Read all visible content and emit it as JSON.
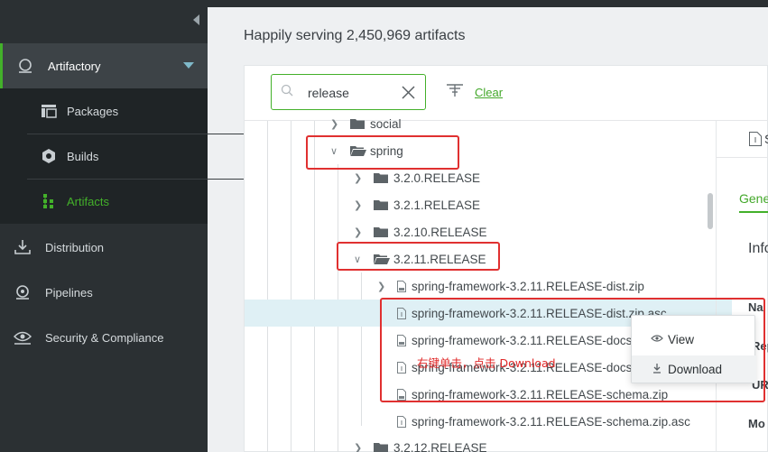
{
  "sidebar": {
    "artifactory_label": "Artifactory",
    "sub_items": [
      {
        "label": "Packages",
        "icon": "packages-icon"
      },
      {
        "label": "Builds",
        "icon": "builds-icon"
      },
      {
        "label": "Artifacts",
        "icon": "artifacts-icon"
      }
    ],
    "items": [
      {
        "label": "Distribution",
        "icon": "distribution-icon"
      },
      {
        "label": "Pipelines",
        "icon": "pipelines-icon"
      },
      {
        "label": "Security & Compliance",
        "icon": "eye-icon"
      }
    ]
  },
  "main": {
    "title": "Happily serving 2,450,969 artifacts",
    "search": {
      "value": "release",
      "placeholder": ""
    },
    "clear_label": "Clear"
  },
  "tree": {
    "rows": [
      {
        "label": "social",
        "kind": "folder",
        "expanded": false
      },
      {
        "label": "spring",
        "kind": "folder-open",
        "expanded": true
      },
      {
        "label": "3.2.0.RELEASE",
        "kind": "folder",
        "expanded": false
      },
      {
        "label": "3.2.1.RELEASE",
        "kind": "folder",
        "expanded": false
      },
      {
        "label": "3.2.10.RELEASE",
        "kind": "folder",
        "expanded": false
      },
      {
        "label": "3.2.11.RELEASE",
        "kind": "folder-open",
        "expanded": true
      },
      {
        "label": "spring-framework-3.2.11.RELEASE-dist.zip",
        "kind": "zip",
        "expanded": false
      },
      {
        "label": "spring-framework-3.2.11.RELEASE-dist.zip.asc",
        "kind": "file"
      },
      {
        "label": "spring-framework-3.2.11.RELEASE-docs.zip",
        "kind": "zip"
      },
      {
        "label": "spring-framework-3.2.11.RELEASE-docs.zip.asc",
        "kind": "file"
      },
      {
        "label": "spring-framework-3.2.11.RELEASE-schema.zip",
        "kind": "zip"
      },
      {
        "label": "spring-framework-3.2.11.RELEASE-schema.zip.asc",
        "kind": "file"
      },
      {
        "label": "3.2.12.RELEASE",
        "kind": "folder",
        "expanded": false
      }
    ]
  },
  "context_menu": {
    "items": [
      {
        "label": "View",
        "icon": "eye-icon"
      },
      {
        "label": "Download",
        "icon": "download-icon"
      }
    ]
  },
  "annotation": "右键单击，点击 Download",
  "right_panel": {
    "tab_fragment": "S",
    "general_fragment": "Gene",
    "info_fragment": "Info",
    "field_fragments": [
      "Na",
      "Rep",
      "URI",
      "Mo"
    ]
  },
  "colors": {
    "accent": "#43b02a",
    "sidebar_bg": "#2b3033",
    "annotation_red": "#e03030",
    "selected_row": "#dff0f5"
  }
}
